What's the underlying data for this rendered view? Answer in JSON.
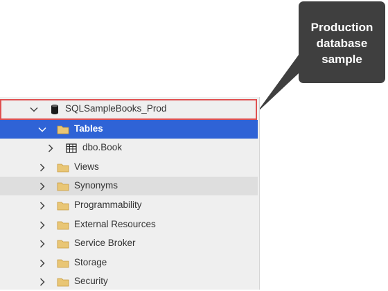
{
  "tree": {
    "database": {
      "name": "SQLSampleBooks_Prod",
      "icon": "database-icon",
      "expanded": true
    },
    "items": [
      {
        "label": "Tables",
        "icon": "folder-icon",
        "expanded": true,
        "selected": true
      },
      {
        "label": "dbo.Book",
        "icon": "table-icon",
        "expanded": false
      },
      {
        "label": "Views",
        "icon": "folder-icon",
        "expanded": false
      },
      {
        "label": "Synonyms",
        "icon": "folder-icon",
        "expanded": false
      },
      {
        "label": "Programmability",
        "icon": "folder-icon",
        "expanded": false
      },
      {
        "label": "External Resources",
        "icon": "folder-icon",
        "expanded": false
      },
      {
        "label": "Service Broker",
        "icon": "folder-icon",
        "expanded": false
      },
      {
        "label": "Storage",
        "icon": "folder-icon",
        "expanded": false
      },
      {
        "label": "Security",
        "icon": "folder-icon",
        "expanded": false
      }
    ]
  },
  "callout": {
    "lines": [
      "Production",
      "database",
      "sample"
    ]
  },
  "colors": {
    "selection": "#2f63d6",
    "highlight_border": "#e05050",
    "callout_bg": "#3f3f3f",
    "folder": "#dcb263"
  }
}
